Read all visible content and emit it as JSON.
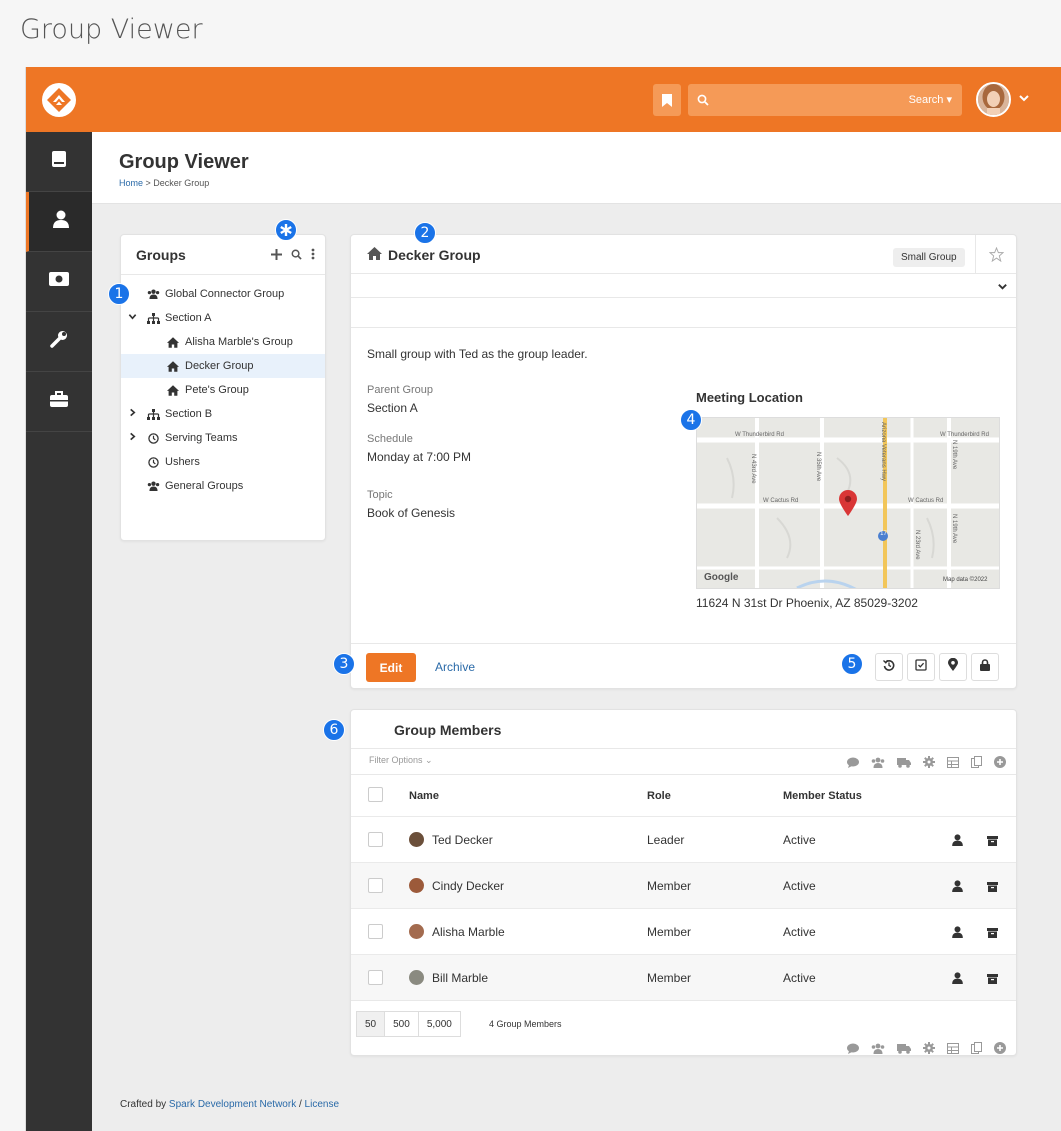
{
  "page_caption": "Group Viewer",
  "topbar": {
    "search_button": "Search ▾",
    "brand_color": "#ee7625",
    "icons": [
      "rock-logo-icon",
      "bookmark-icon",
      "search-icon",
      "avatar",
      "chevron-down-icon"
    ]
  },
  "sidebar": {
    "items": [
      {
        "icon": "book-icon",
        "active": false
      },
      {
        "icon": "person-icon",
        "active": true
      },
      {
        "icon": "money-icon",
        "active": false
      },
      {
        "icon": "wrench-icon",
        "active": false
      },
      {
        "icon": "briefcase-icon",
        "active": false
      }
    ]
  },
  "header": {
    "title": "Group Viewer",
    "breadcrumb_home": "Home",
    "breadcrumb_sep": " > ",
    "breadcrumb_current": "Decker Group"
  },
  "groups_panel": {
    "title": "Groups",
    "tree": [
      {
        "label": "Global Connector Group",
        "icon": "users-icon",
        "caret": "",
        "selected": false
      },
      {
        "label": "Section A",
        "icon": "sitemap-icon",
        "caret": "down",
        "selected": false
      },
      {
        "label": "Alisha Marble's Group",
        "icon": "home-icon",
        "caret": "",
        "selected": false
      },
      {
        "label": "Decker Group",
        "icon": "home-icon",
        "caret": "",
        "selected": true
      },
      {
        "label": "Pete's Group",
        "icon": "home-icon",
        "caret": "",
        "selected": false
      },
      {
        "label": "Section B",
        "icon": "sitemap-icon",
        "caret": "right",
        "selected": false
      },
      {
        "label": "Serving Teams",
        "icon": "clock-icon",
        "caret": "right",
        "selected": false
      },
      {
        "label": "Ushers",
        "icon": "clock-icon",
        "caret": "",
        "selected": false
      },
      {
        "label": "General Groups",
        "icon": "users-icon",
        "caret": "",
        "selected": false
      }
    ]
  },
  "group_detail": {
    "title": "Decker Group",
    "badge": "Small Group",
    "description": "Small group with Ted as the group leader.",
    "parent_group_label": "Parent Group",
    "parent_group_value": "Section A",
    "schedule_label": "Schedule",
    "schedule_value": "Monday at 7:00 PM",
    "topic_label": "Topic",
    "topic_value": "Book of Genesis",
    "meeting_location_title": "Meeting Location",
    "address": "11624 N 31st Dr Phoenix, AZ 85029-3202",
    "map": {
      "roads": [
        "W Thunderbird Rd",
        "W Thunderbird Rd",
        "W Cactus Rd",
        "W Cactus Rd",
        "N 43rd Ave",
        "N 35th Ave",
        "Arizona Veterans Hwy",
        "N 19th Ave",
        "N 23rd Ave",
        "N 19th Ave"
      ],
      "highway_shield": "17",
      "google": "Google",
      "attribution": "Map data ©2022"
    },
    "edit_button": "Edit",
    "archive_button": "Archive"
  },
  "members": {
    "title": "Group Members",
    "filter": "Filter Options ⌄",
    "columns": [
      "Name",
      "Role",
      "Member Status"
    ],
    "rows": [
      {
        "name": "Ted Decker",
        "role": "Leader",
        "status": "Active",
        "face": "#6b4f3a"
      },
      {
        "name": "Cindy Decker",
        "role": "Member",
        "status": "Active",
        "face": "#9c5a3a"
      },
      {
        "name": "Alisha Marble",
        "role": "Member",
        "status": "Active",
        "face": "#a36b4f"
      },
      {
        "name": "Bill Marble",
        "role": "Member",
        "status": "Active",
        "face": "#8a8a80"
      }
    ],
    "page_sizes": [
      "50",
      "500",
      "5,000"
    ],
    "count_text": "4 Group Members"
  },
  "footer": {
    "prefix": "Crafted by ",
    "link1": "Spark Development Network",
    "sep": " / ",
    "link2": "License"
  },
  "callouts": [
    "1",
    "2",
    "3",
    "4",
    "5",
    "6"
  ]
}
